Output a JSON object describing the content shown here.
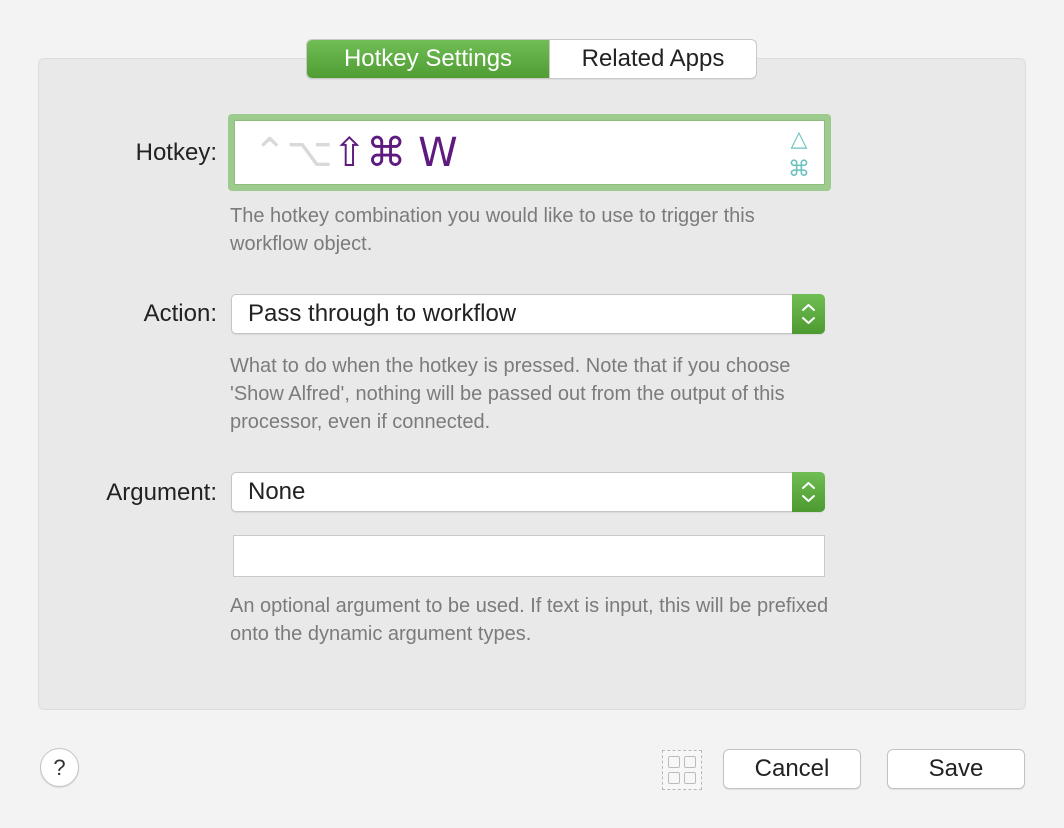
{
  "tabs": [
    {
      "label": "Hotkey Settings",
      "active": true
    },
    {
      "label": "Related Apps",
      "active": false
    }
  ],
  "hotkey": {
    "label": "Hotkey:",
    "modifiers": {
      "control": "⌃",
      "option": "⌥",
      "shift": "⇧",
      "command": "⌘"
    },
    "active_modifiers": [
      "shift",
      "command"
    ],
    "key": "W",
    "side_icons": [
      "△",
      "⌘"
    ],
    "help": "The hotkey combination you would like to use to trigger this workflow object."
  },
  "action": {
    "label": "Action:",
    "value": "Pass through to workflow",
    "help": "What to do when the hotkey is pressed. Note that if you choose 'Show Alfred', nothing will be passed out from the output of this processor, even if connected."
  },
  "argument": {
    "label": "Argument:",
    "value": "None",
    "text_value": "",
    "help": "An optional argument to be used. If text is input, this will be prefixed onto the dynamic argument types."
  },
  "footer": {
    "help_label": "?",
    "cancel_label": "Cancel",
    "save_label": "Save"
  },
  "colors": {
    "accent_green": "#5aa83e",
    "hotkey_purple": "#5e1a7e",
    "modifier_inactive": "#d9d9d9",
    "side_icon_teal": "#6dc2bf"
  },
  "icons": {
    "help": "question-mark-icon",
    "grid": "grid-icon",
    "stepper": "up-down-chevron-icon"
  }
}
